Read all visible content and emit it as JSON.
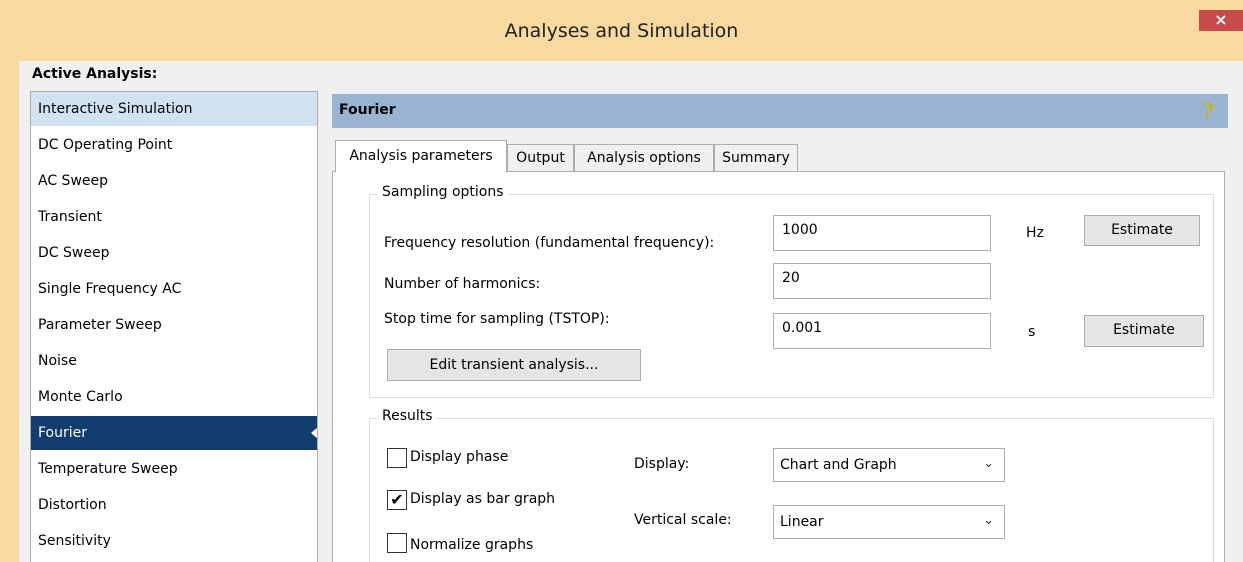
{
  "window": {
    "title": "Analyses and Simulation",
    "close_glyph": "×"
  },
  "active_analysis_label": "Active Analysis:",
  "analyses": [
    {
      "label": "Interactive Simulation",
      "state": "hover"
    },
    {
      "label": "DC Operating Point",
      "state": "normal"
    },
    {
      "label": "AC Sweep",
      "state": "normal"
    },
    {
      "label": "Transient",
      "state": "normal"
    },
    {
      "label": "DC Sweep",
      "state": "normal"
    },
    {
      "label": "Single Frequency AC",
      "state": "normal"
    },
    {
      "label": "Parameter Sweep",
      "state": "normal"
    },
    {
      "label": "Noise",
      "state": "normal"
    },
    {
      "label": "Monte Carlo",
      "state": "normal"
    },
    {
      "label": "Fourier",
      "state": "selected"
    },
    {
      "label": "Temperature Sweep",
      "state": "normal"
    },
    {
      "label": "Distortion",
      "state": "normal"
    },
    {
      "label": "Sensitivity",
      "state": "normal"
    }
  ],
  "panel": {
    "title": "Fourier",
    "help_glyph": "?",
    "tabs": [
      {
        "label": "Analysis parameters",
        "active": true
      },
      {
        "label": "Output",
        "active": false
      },
      {
        "label": "Analysis options",
        "active": false
      },
      {
        "label": "Summary",
        "active": false
      }
    ]
  },
  "sampling": {
    "title": "Sampling options",
    "freq_label": "Frequency resolution (fundamental frequency):",
    "freq_value": "1000",
    "freq_unit": "Hz",
    "estimate1_label": "Estimate",
    "harmonics_label": "Number of harmonics:",
    "harmonics_value": "20",
    "tstop_label": "Stop time for sampling (TSTOP):",
    "tstop_value": "0.001",
    "tstop_unit": "s",
    "estimate2_label": "Estimate",
    "edit_transient_label": "Edit transient analysis..."
  },
  "results": {
    "title": "Results",
    "display_phase_label": "Display phase",
    "display_phase_checked": false,
    "bar_graph_label": "Display as bar graph",
    "bar_graph_checked": true,
    "normalize_label": "Normalize graphs",
    "normalize_checked": false,
    "check_glyph": "✔",
    "display_label": "Display:",
    "display_value": "Chart and Graph",
    "vscale_label": "Vertical scale:",
    "vscale_value": "Linear",
    "chevron_glyph": "⌄"
  },
  "colors": {
    "titlebar": "#f8d9a0",
    "close": "#c74b4b",
    "header": "#99b4d1",
    "selected": "#123d6f",
    "hover": "#d1e2f0"
  }
}
